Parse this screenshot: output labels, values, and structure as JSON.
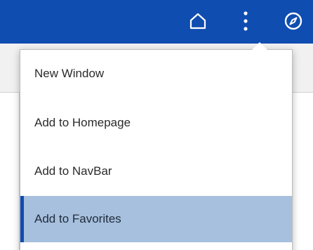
{
  "header": {
    "icons": [
      "home-icon",
      "more-vertical-icon",
      "compass-icon"
    ]
  },
  "menu": {
    "items": [
      {
        "label": "New Window"
      },
      {
        "label": "Add to Homepage"
      },
      {
        "label": "Add to NavBar"
      },
      {
        "label": "Add to Favorites",
        "selected": true
      }
    ]
  },
  "colors": {
    "header_bg": "#0f4db0",
    "selected_bg": "#a7c0de",
    "selected_accent": "#0f4db0",
    "menu_text": "#2b2b2b"
  }
}
